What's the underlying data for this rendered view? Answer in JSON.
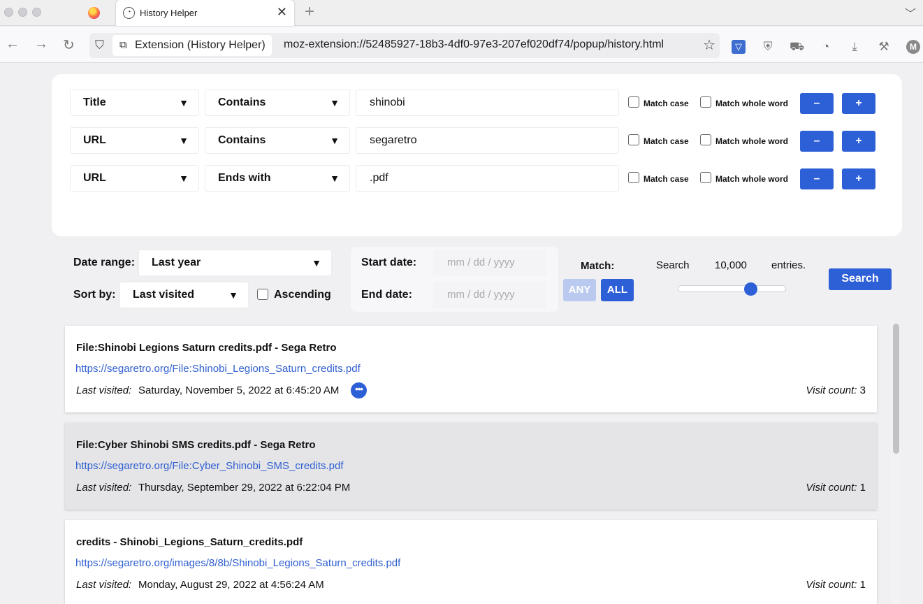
{
  "browser": {
    "tab_title": "History Helper",
    "tab_close": "✕",
    "new_tab": "+",
    "ext_chip": "Extension (History Helper)",
    "url": "moz-extension://52485927-18b3-4df0-97e3-207ef020df74/popup/history.html",
    "avatar_letter": "M"
  },
  "filters": [
    {
      "field": "Title",
      "op": "Contains",
      "value": "shinobi",
      "match_case": "Match case",
      "match_whole": "Match whole word"
    },
    {
      "field": "URL",
      "op": "Contains",
      "value": "segaretro",
      "match_case": "Match case",
      "match_whole": "Match whole word"
    },
    {
      "field": "URL",
      "op": "Ends with",
      "value": ".pdf",
      "match_case": "Match case",
      "match_whole": "Match whole word"
    }
  ],
  "buttons": {
    "minus": "–",
    "plus": "+",
    "any": "ANY",
    "all": "ALL",
    "search": "Search"
  },
  "controls": {
    "date_range_label": "Date range:",
    "date_range_value": "Last year",
    "sort_by_label": "Sort by:",
    "sort_by_value": "Last visited",
    "ascending_label": "Ascending",
    "start_date_label": "Start date:",
    "end_date_label": "End date:",
    "date_placeholder": "mm / dd / yyyy",
    "match_label": "Match:",
    "search_prefix": "Search",
    "search_count": "10,000",
    "search_suffix": "entries.",
    "slider_fraction": 0.7
  },
  "results": [
    {
      "title": "File:Shinobi Legions Saturn credits.pdf - Sega Retro",
      "url": "https://segaretro.org/File:Shinobi_Legions_Saturn_credits.pdf",
      "last_visited_label": "Last visited:",
      "last_visited": "Saturday, November 5, 2022 at 6:45:20 AM",
      "visit_count_label": "Visit count:",
      "visit_count": "3"
    },
    {
      "title": "File:Cyber Shinobi SMS credits.pdf - Sega Retro",
      "url": "https://segaretro.org/File:Cyber_Shinobi_SMS_credits.pdf",
      "last_visited_label": "Last visited:",
      "last_visited": "Thursday, September 29, 2022 at 6:22:04 PM",
      "visit_count_label": "Visit count:",
      "visit_count": "1"
    },
    {
      "title": "credits - Shinobi_Legions_Saturn_credits.pdf",
      "url": "https://segaretro.org/images/8/8b/Shinobi_Legions_Saturn_credits.pdf",
      "last_visited_label": "Last visited:",
      "last_visited": "Monday, August 29, 2022 at 4:56:24 AM",
      "visit_count_label": "Visit count:",
      "visit_count": "1"
    }
  ]
}
